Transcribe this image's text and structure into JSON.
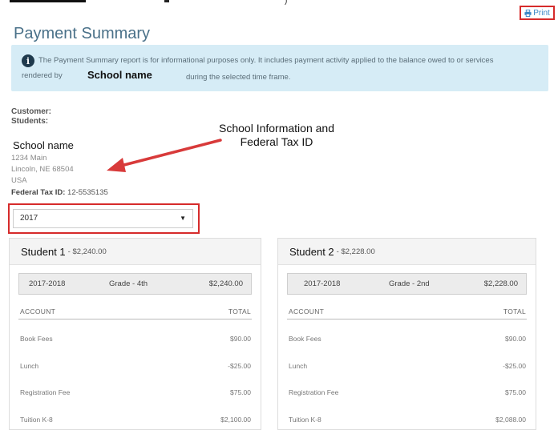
{
  "page": {
    "title": "Payment Summary",
    "print_label": "Print"
  },
  "info": {
    "line1": "The Payment Summary report is for informational purposes only. It includes payment activity applied to the balance owed to or services",
    "line2_prefix": "rendered by",
    "school_placeholder": "School name",
    "line2_suffix": "during the selected time frame."
  },
  "customer": {
    "customer_label": "Customer:",
    "students_label": "Students:"
  },
  "annotation": {
    "line1": "School Information and",
    "line2": "Federal Tax ID"
  },
  "school": {
    "name": "School name",
    "address1": "1234 Main",
    "address2": "Lincoln, NE 68504",
    "country": "USA",
    "tax_label": "Federal Tax ID:",
    "tax_id": "12-5535135"
  },
  "year_select": {
    "value": "2017",
    "caret": "▼"
  },
  "students": [
    {
      "name": "Student 1",
      "amount": " - $2,240.00",
      "term": "2017-2018",
      "grade": "Grade - 4th",
      "term_total": "$2,240.00",
      "account_header": "ACCOUNT",
      "total_header": "TOTAL",
      "items": [
        {
          "label": "Book Fees",
          "value": "$90.00"
        },
        {
          "label": "Lunch",
          "value": "-$25.00"
        },
        {
          "label": "Registration Fee",
          "value": "$75.00"
        },
        {
          "label": "Tuition K-8",
          "value": "$2,100.00"
        }
      ]
    },
    {
      "name": "Student 2",
      "amount": " - $2,228.00",
      "term": "2017-2018",
      "grade": "Grade - 2nd",
      "term_total": "$2,228.00",
      "account_header": "ACCOUNT",
      "total_header": "TOTAL",
      "items": [
        {
          "label": "Book Fees",
          "value": "$90.00"
        },
        {
          "label": "Lunch",
          "value": "-$25.00"
        },
        {
          "label": "Registration Fee",
          "value": "$75.00"
        },
        {
          "label": "Tuition K-8",
          "value": "$2,088.00"
        }
      ]
    }
  ]
}
